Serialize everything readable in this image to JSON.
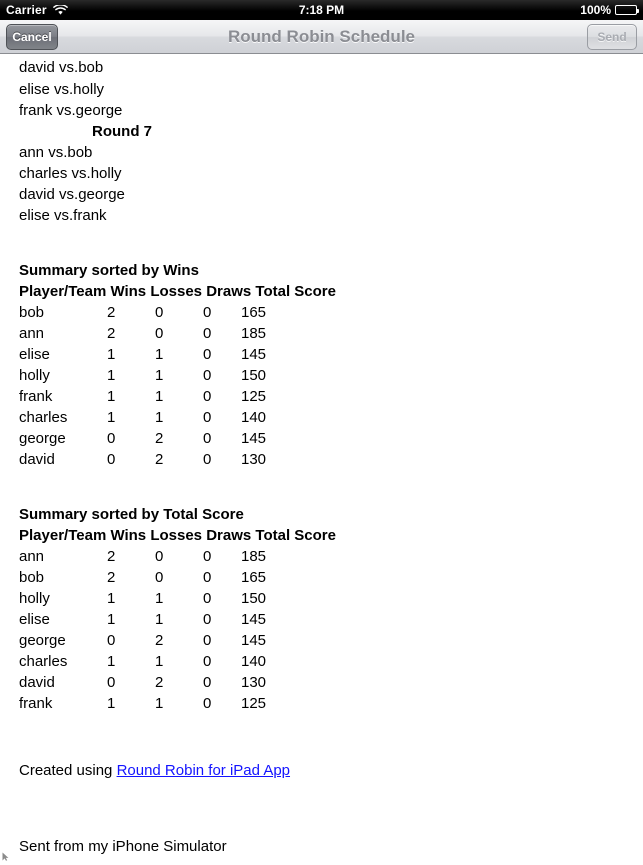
{
  "status_bar": {
    "carrier": "Carrier",
    "wifi_icon": "wifi-icon",
    "time": "7:18 PM",
    "battery_percent": "100%",
    "battery_icon": "battery-full-icon"
  },
  "nav_bar": {
    "cancel_label": "Cancel",
    "title": "Round Robin Schedule",
    "send_label": "Send"
  },
  "body": {
    "top_matches": [
      "david vs.bob",
      "elise vs.holly",
      "frank vs.george"
    ],
    "round_heading": "Round 7",
    "round_matches": [
      "ann vs.bob",
      "charles vs.holly",
      "david vs.george",
      "elise vs.frank"
    ],
    "summary_wins": {
      "title": "Summary sorted by Wins",
      "headers": {
        "player": "Player/Team",
        "wins": "Wins",
        "losses": "Losses",
        "draws": "Draws",
        "score": "Total Score"
      },
      "rows": [
        {
          "player": "bob",
          "wins": "2",
          "losses": "0",
          "draws": "0",
          "score": "165"
        },
        {
          "player": "ann",
          "wins": "2",
          "losses": "0",
          "draws": "0",
          "score": "185"
        },
        {
          "player": "elise",
          "wins": "1",
          "losses": "1",
          "draws": "0",
          "score": "145"
        },
        {
          "player": "holly",
          "wins": "1",
          "losses": "1",
          "draws": "0",
          "score": "150"
        },
        {
          "player": "frank",
          "wins": "1",
          "losses": "1",
          "draws": "0",
          "score": "125"
        },
        {
          "player": "charles",
          "wins": "1",
          "losses": "1",
          "draws": "0",
          "score": "140"
        },
        {
          "player": "george",
          "wins": "0",
          "losses": "2",
          "draws": "0",
          "score": "145"
        },
        {
          "player": "david",
          "wins": "0",
          "losses": "2",
          "draws": "0",
          "score": "130"
        }
      ]
    },
    "summary_score": {
      "title": "Summary sorted by Total Score",
      "headers": {
        "player": "Player/Team",
        "wins": "Wins",
        "losses": "Losses",
        "draws": "Draws",
        "score": "Total Score"
      },
      "rows": [
        {
          "player": "ann",
          "wins": "2",
          "losses": "0",
          "draws": "0",
          "score": "185"
        },
        {
          "player": "bob",
          "wins": "2",
          "losses": "0",
          "draws": "0",
          "score": "165"
        },
        {
          "player": "holly",
          "wins": "1",
          "losses": "1",
          "draws": "0",
          "score": "150"
        },
        {
          "player": "elise",
          "wins": "1",
          "losses": "1",
          "draws": "0",
          "score": "145"
        },
        {
          "player": "george",
          "wins": "0",
          "losses": "2",
          "draws": "0",
          "score": "145"
        },
        {
          "player": "charles",
          "wins": "1",
          "losses": "1",
          "draws": "0",
          "score": "140"
        },
        {
          "player": "david",
          "wins": "0",
          "losses": "2",
          "draws": "0",
          "score": "130"
        },
        {
          "player": "frank",
          "wins": "1",
          "losses": "1",
          "draws": "0",
          "score": "125"
        }
      ]
    },
    "credit_prefix": "Created using ",
    "credit_link": "Round Robin for iPad App",
    "signature": "Sent from my iPhone Simulator"
  },
  "colors": {
    "link": "#1414ff",
    "nav_title": "#8b8d93",
    "status_bar_bg": "#000000"
  }
}
